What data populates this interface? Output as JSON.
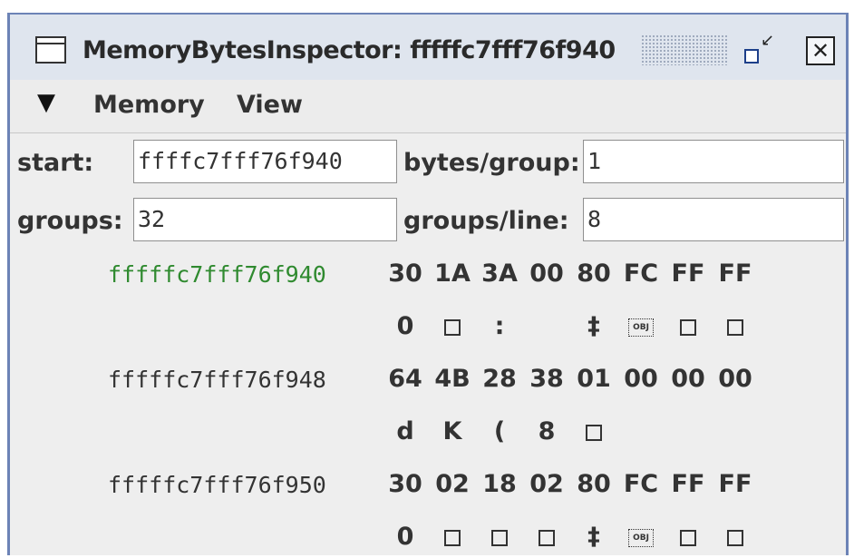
{
  "window": {
    "title": "MemoryBytesInspector: fffffc7fff76f940",
    "restore_symbol": "↙",
    "close_symbol": "✕"
  },
  "menubar": {
    "arrow": "▼",
    "items": [
      "Memory",
      "View"
    ]
  },
  "form": {
    "start_label": "start:",
    "start_value": "ffffc7fff76f940",
    "bytes_group_label": "bytes/group:",
    "bytes_group_value": "1",
    "groups_label": "groups:",
    "groups_value": "32",
    "groups_line_label": "groups/line:",
    "groups_line_value": "8"
  },
  "dump": [
    {
      "address": "fffffc7fff76f940",
      "current": true,
      "bytes": [
        "30",
        "1A",
        "3A",
        "00",
        "80",
        "FC",
        "FF",
        "FF"
      ],
      "chars": [
        "0",
        "box",
        ":",
        "",
        "‡",
        "obj",
        "box",
        "box"
      ]
    },
    {
      "address": "fffffc7fff76f948",
      "current": false,
      "bytes": [
        "64",
        "4B",
        "28",
        "38",
        "01",
        "00",
        "00",
        "00"
      ],
      "chars": [
        "d",
        "K",
        "(",
        "8",
        "box",
        "",
        "",
        ""
      ]
    },
    {
      "address": "fffffc7fff76f950",
      "current": false,
      "bytes": [
        "30",
        "02",
        "18",
        "02",
        "80",
        "FC",
        "FF",
        "FF"
      ],
      "chars": [
        "0",
        "box",
        "box",
        "box",
        "‡",
        "obj",
        "box",
        "box"
      ]
    }
  ],
  "icons": {
    "window": "window-icon",
    "grip": "grip-icon",
    "restore": "restore-icon",
    "close": "close-icon"
  },
  "colors": {
    "current_address": "#2f8a2f",
    "frame_border": "#6c83b6",
    "titlebar": "#dfe5ee"
  },
  "obj_glyph_text": "OBJ"
}
